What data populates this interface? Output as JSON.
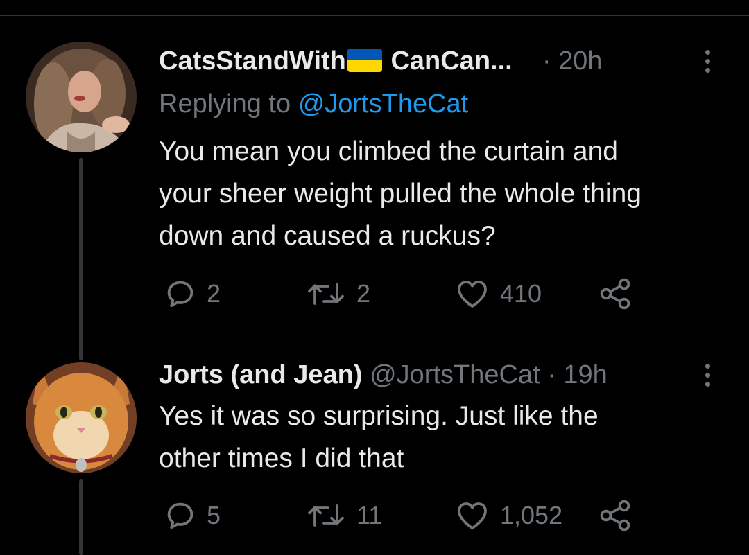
{
  "tweets": [
    {
      "display_name": "CatsStandWith",
      "display_name_suffix": "CanCan...",
      "flag_icon": "ukraine-flag-icon",
      "flag_colors": [
        "#0057b7",
        "#ffd700"
      ],
      "handle": "",
      "timestamp": "· 20h",
      "replying_label": "Replying to",
      "replying_to": "@JortsTheCat",
      "text_lines": [
        "You mean you climbed the curtain and",
        "your sheer weight pulled the whole thing",
        "down and caused a ruckus?"
      ],
      "actions": {
        "replies": "2",
        "retweets": "2",
        "likes": "410"
      }
    },
    {
      "display_name": "Jorts (and Jean)",
      "handle": "@JortsTheCat",
      "timestamp": "· 19h",
      "text_lines": [
        "Yes it was so surprising. Just like the",
        "other times I did that"
      ],
      "actions": {
        "replies": "5",
        "retweets": "11",
        "likes": "1,052"
      }
    }
  ],
  "icons": {
    "reply": "reply-icon",
    "retweet": "retweet-icon",
    "like": "heart-icon",
    "share": "share-icon",
    "more": "more-icon"
  },
  "colors": {
    "background": "#000000",
    "text_primary": "#e7e9ea",
    "text_secondary": "#71767b",
    "accent": "#1d9bf0",
    "thread_line": "#333639"
  }
}
